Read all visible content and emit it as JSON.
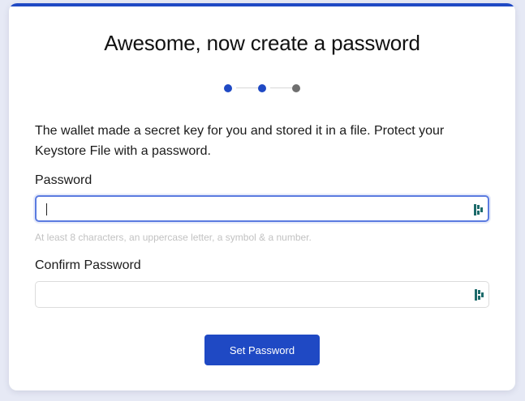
{
  "header": {
    "title": "Awesome, now create a password"
  },
  "stepper": {
    "total_steps": 3,
    "current_step": 2,
    "colors": {
      "complete": "#1f49c4",
      "pending": "#6f6f6f",
      "line": "#d7d7d7"
    }
  },
  "description": "The wallet made a secret key for you and stored it in a file. Protect your Keystore File with a password.",
  "form": {
    "password": {
      "label": "Password",
      "value": "",
      "placeholder": "",
      "hint": "At least 8 characters, an uppercase letter, a symbol & a number.",
      "icon": "password-manager-icon",
      "focused": true
    },
    "confirm_password": {
      "label": "Confirm Password",
      "value": "",
      "placeholder": "",
      "icon": "password-manager-icon",
      "focused": false
    },
    "submit_label": "Set Password"
  },
  "colors": {
    "accent": "#1f49c4",
    "focus_ring": "#5b7be0",
    "icon_teal": "#1d6b6b",
    "page_background": "#e6e9f5",
    "hint_text": "#c2c2c2"
  }
}
